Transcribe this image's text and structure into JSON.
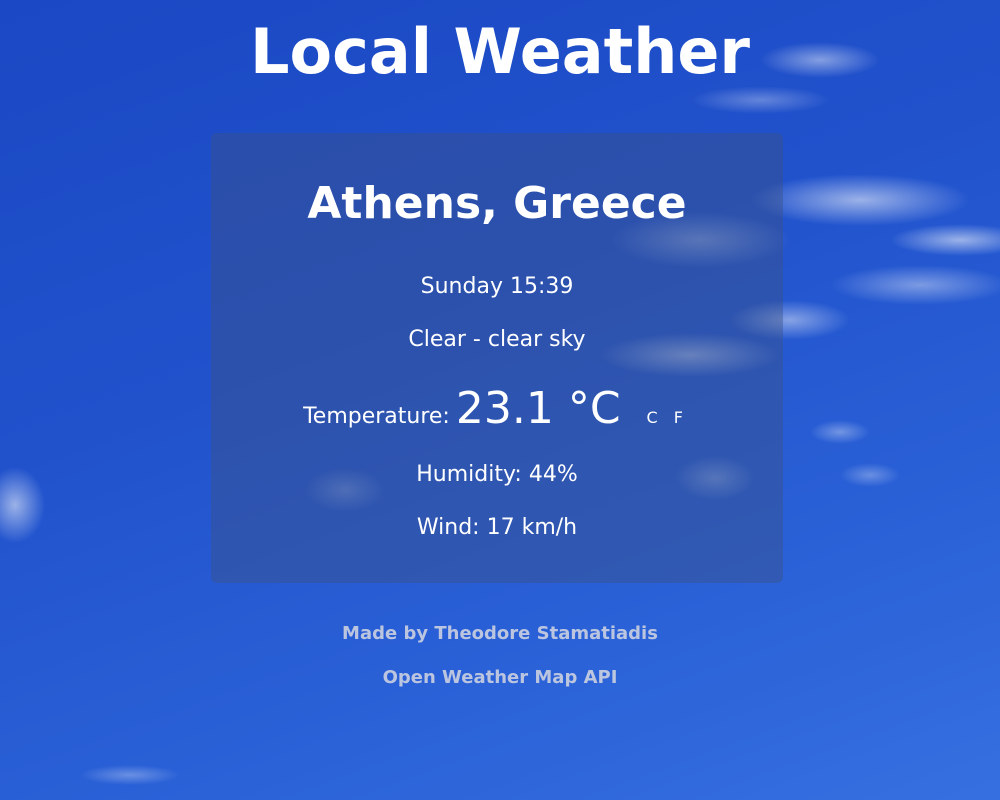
{
  "header": {
    "title": "Local Weather"
  },
  "weather": {
    "location": "Athens, Greece",
    "datetime": "Sunday 15:39",
    "condition": "Clear - clear sky",
    "temperature_label": "Temperature:",
    "temperature_value": "23.1 °C",
    "unit_celsius": "C",
    "unit_fahrenheit": "F",
    "humidity": "Humidity: 44%",
    "wind": "Wind: 17 km/h"
  },
  "footer": {
    "credit": "Made by Theodore Stamatiadis",
    "api": "Open Weather Map API"
  },
  "colors": {
    "sky_background": "#2152cc",
    "card_background": "#3c5082",
    "text": "#ffffff",
    "footer_text": "#dcdce1"
  }
}
